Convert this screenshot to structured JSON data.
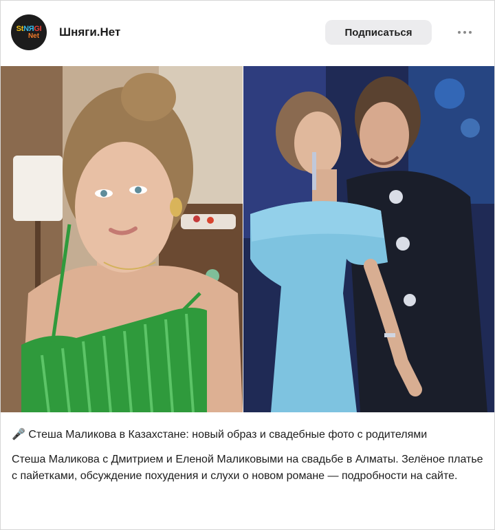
{
  "header": {
    "channel_name": "Шняги.Нет",
    "avatar_text_line1_a": "St",
    "avatar_text_line1_b": "NЯ",
    "avatar_text_line1_c": "GI",
    "avatar_text_line2": "Net",
    "subscribe_label": "Подписаться",
    "more_icon": "more-horizontal-icon"
  },
  "post": {
    "headline_icon": "🎤",
    "headline": "Стеша Маликова в Казахстане: новый образ и свадебные фото с родителями",
    "body": "Стеша Маликова с Дмитрием и Еленой Маликовыми на свадьбе в Алматы. Зелёное платье с пайетками, обсуждение похудения и слухи о новом романе — подробности на сайте."
  },
  "colors": {
    "subscribe_bg": "#ececee",
    "dress_green": "#2f9a3c",
    "dress_blue": "#7ec3e0"
  }
}
